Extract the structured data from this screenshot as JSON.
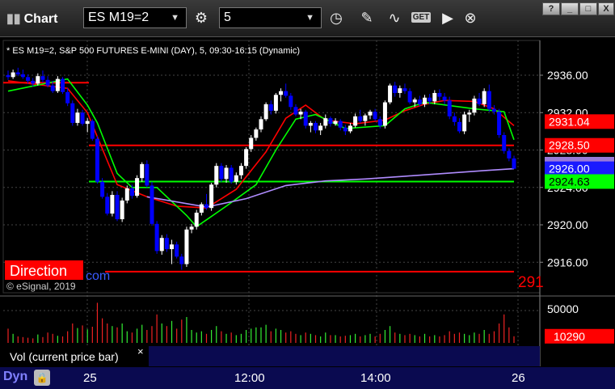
{
  "window": {
    "title": "Chart",
    "symbol": "ES M19=2",
    "interval": "5",
    "get_label": "GET",
    "help_label": "?",
    "minimize_label": "_",
    "maximize_label": "□",
    "close_label": "X"
  },
  "chart_info": {
    "header": "* ES M19=2, S&P 500 FUTURES E-MINI (DAY), 5, 09:30-16:15 (Dynamic)",
    "copyright": "© eSignal, 2019",
    "watermark": "Direction",
    "watermark_suffix": "com",
    "right_cut_label": "291"
  },
  "price_labels": [
    {
      "text": "2931.04",
      "value": 2931.04,
      "bg": "#ff0000",
      "fg": "#ffffff"
    },
    {
      "text": "2928.50",
      "value": 2928.5,
      "bg": "#ff0000",
      "fg": "#ffffff"
    },
    {
      "text": "2926.00",
      "value": 2926.0,
      "bg": "#1a1aff",
      "fg": "#ffffff"
    },
    {
      "text": "2924.63",
      "value": 2924.63,
      "bg": "#00ff00",
      "fg": "#000000"
    }
  ],
  "volume_panel": {
    "label": "Vol (current price bar)",
    "close_label": "×",
    "tick": "50000",
    "current_volume": "10290"
  },
  "bottom_bar": {
    "mode": "Dyn",
    "x_labels": [
      "25",
      "12:00",
      "14:00",
      "26"
    ]
  },
  "colors": {
    "up": "#ffffff",
    "down": "#0000ff",
    "red_ma": "#ff0000",
    "green_ma": "#00ff00",
    "purple_ma": "#b08cff",
    "grid": "#444444",
    "level_red": "#ff0000",
    "level_green": "#00ff00"
  },
  "chart_data": {
    "type": "candlestick",
    "y_ticks": [
      2936,
      2932,
      2928,
      2924,
      2920,
      2916
    ],
    "y_tick_labels": [
      "2936.00",
      "2932.00",
      "2928.00",
      "2924.00",
      "2920.00",
      "2916.00"
    ],
    "ylim": [
      2914.0,
      2940.5
    ],
    "x_labels": [
      "25",
      "12:00",
      "14:00",
      "26"
    ],
    "horizontal_levels": [
      {
        "value": 2935.2,
        "color": "red",
        "extent": "first_session"
      },
      {
        "value": 2928.5,
        "color": "red",
        "extent": "full"
      },
      {
        "value": 2924.63,
        "color": "green",
        "extent": "full"
      },
      {
        "value": 2915.0,
        "color": "red",
        "extent": "full"
      }
    ],
    "candles": [
      [
        2936.0,
        2936.5,
        2935.5,
        2935.8
      ],
      [
        2935.8,
        2936.6,
        2935.6,
        2936.3
      ],
      [
        2936.3,
        2936.8,
        2935.9,
        2936.1
      ],
      [
        2936.1,
        2936.6,
        2935.6,
        2935.8
      ],
      [
        2935.8,
        2936.1,
        2935.1,
        2935.4
      ],
      [
        2935.4,
        2935.7,
        2934.8,
        2935.1
      ],
      [
        2935.1,
        2936.2,
        2934.9,
        2935.9
      ],
      [
        2935.9,
        2936.5,
        2935.2,
        2935.5
      ],
      [
        2935.5,
        2935.9,
        2934.7,
        2934.9
      ],
      [
        2934.9,
        2935.4,
        2934.1,
        2934.3
      ],
      [
        2934.3,
        2935.9,
        2934.1,
        2935.6
      ],
      [
        2935.6,
        2935.8,
        2934.0,
        2934.2
      ],
      [
        2934.2,
        2934.6,
        2932.7,
        2933.0
      ],
      [
        2933.0,
        2933.3,
        2930.6,
        2930.9
      ],
      [
        2930.9,
        2932.4,
        2930.6,
        2932.0
      ],
      [
        2932.0,
        2932.3,
        2930.6,
        2930.8
      ],
      [
        2930.8,
        2931.4,
        2929.9,
        2931.1
      ],
      [
        2931.1,
        2931.3,
        2929.0,
        2929.2
      ],
      [
        2929.2,
        2929.5,
        2924.4,
        2924.6
      ],
      [
        2924.6,
        2925.0,
        2922.8,
        2923.0
      ],
      [
        2923.0,
        2923.4,
        2921.0,
        2921.2
      ],
      [
        2921.2,
        2923.6,
        2920.9,
        2923.2
      ],
      [
        2923.2,
        2923.6,
        2920.4,
        2920.6
      ],
      [
        2920.6,
        2922.9,
        2920.3,
        2922.6
      ],
      [
        2922.6,
        2924.2,
        2922.3,
        2923.9
      ],
      [
        2923.9,
        2924.3,
        2922.8,
        2923.1
      ],
      [
        2923.1,
        2925.3,
        2922.9,
        2925.0
      ],
      [
        2925.0,
        2926.7,
        2924.6,
        2926.5
      ],
      [
        2926.5,
        2926.9,
        2924.0,
        2924.2
      ],
      [
        2924.2,
        2924.6,
        2919.9,
        2920.1
      ],
      [
        2920.1,
        2920.4,
        2916.9,
        2917.2
      ],
      [
        2917.2,
        2918.9,
        2916.8,
        2918.6
      ],
      [
        2918.6,
        2919.0,
        2917.1,
        2917.4
      ],
      [
        2917.4,
        2918.4,
        2915.8,
        2917.9
      ],
      [
        2917.9,
        2918.2,
        2916.4,
        2916.6
      ],
      [
        2916.6,
        2916.9,
        2915.2,
        2915.8
      ],
      [
        2915.8,
        2919.8,
        2915.5,
        2919.5
      ],
      [
        2919.5,
        2920.1,
        2919.1,
        2919.8
      ],
      [
        2919.8,
        2921.6,
        2919.5,
        2921.3
      ],
      [
        2921.3,
        2922.4,
        2921.0,
        2922.2
      ],
      [
        2922.2,
        2923.3,
        2921.6,
        2921.8
      ],
      [
        2921.8,
        2924.5,
        2921.5,
        2924.3
      ],
      [
        2924.3,
        2926.6,
        2924.0,
        2926.3
      ],
      [
        2926.3,
        2926.6,
        2924.6,
        2924.9
      ],
      [
        2924.9,
        2926.4,
        2924.5,
        2926.1
      ],
      [
        2926.1,
        2926.4,
        2924.4,
        2924.6
      ],
      [
        2924.6,
        2925.6,
        2924.3,
        2925.3
      ],
      [
        2925.3,
        2926.6,
        2924.9,
        2926.3
      ],
      [
        2926.3,
        2928.3,
        2926.0,
        2928.1
      ],
      [
        2928.1,
        2929.6,
        2927.8,
        2929.3
      ],
      [
        2929.3,
        2930.4,
        2929.0,
        2930.2
      ],
      [
        2930.2,
        2931.6,
        2929.9,
        2931.3
      ],
      [
        2931.3,
        2933.1,
        2931.1,
        2932.9
      ],
      [
        2932.9,
        2933.3,
        2931.8,
        2932.2
      ],
      [
        2932.2,
        2934.1,
        2931.9,
        2933.9
      ],
      [
        2933.9,
        2934.6,
        2933.2,
        2934.3
      ],
      [
        2934.3,
        2935.1,
        2933.6,
        2933.8
      ],
      [
        2933.8,
        2934.1,
        2932.3,
        2932.6
      ],
      [
        2932.6,
        2932.9,
        2931.6,
        2931.8
      ],
      [
        2931.8,
        2932.4,
        2931.3,
        2932.1
      ],
      [
        2932.1,
        2932.3,
        2930.3,
        2930.6
      ],
      [
        2930.6,
        2931.1,
        2929.9,
        2930.9
      ],
      [
        2930.9,
        2931.1,
        2929.8,
        2930.1
      ],
      [
        2930.1,
        2930.9,
        2929.6,
        2930.6
      ],
      [
        2930.6,
        2931.8,
        2930.3,
        2931.4
      ],
      [
        2931.4,
        2931.6,
        2930.5,
        2930.8
      ],
      [
        2930.8,
        2931.4,
        2930.6,
        2931.1
      ],
      [
        2931.1,
        2931.3,
        2930.1,
        2930.4
      ],
      [
        2930.4,
        2930.7,
        2929.6,
        2930.0
      ],
      [
        2930.0,
        2930.9,
        2929.8,
        2930.6
      ],
      [
        2930.6,
        2931.9,
        2930.4,
        2931.6
      ],
      [
        2931.6,
        2932.3,
        2930.9,
        2931.1
      ],
      [
        2931.1,
        2931.9,
        2930.6,
        2931.7
      ],
      [
        2931.7,
        2932.3,
        2931.3,
        2932.1
      ],
      [
        2932.1,
        2932.4,
        2931.1,
        2931.3
      ],
      [
        2931.3,
        2931.6,
        2930.3,
        2930.6
      ],
      [
        2930.6,
        2933.3,
        2930.3,
        2933.1
      ],
      [
        2933.1,
        2935.1,
        2932.9,
        2934.9
      ],
      [
        2934.9,
        2935.3,
        2933.7,
        2934.1
      ],
      [
        2934.1,
        2934.9,
        2933.6,
        2934.6
      ],
      [
        2934.6,
        2935.1,
        2934.0,
        2934.3
      ],
      [
        2934.3,
        2934.6,
        2932.9,
        2933.1
      ],
      [
        2933.1,
        2933.6,
        2932.6,
        2933.4
      ],
      [
        2933.4,
        2933.8,
        2932.7,
        2932.9
      ],
      [
        2932.9,
        2933.9,
        2932.6,
        2933.6
      ],
      [
        2933.6,
        2934.0,
        2932.9,
        2933.2
      ],
      [
        2933.2,
        2934.4,
        2932.9,
        2934.1
      ],
      [
        2934.1,
        2934.5,
        2933.3,
        2933.7
      ],
      [
        2933.7,
        2934.1,
        2932.9,
        2933.3
      ],
      [
        2933.3,
        2933.7,
        2931.3,
        2931.6
      ],
      [
        2931.6,
        2932.0,
        2930.6,
        2931.0
      ],
      [
        2931.0,
        2931.4,
        2929.8,
        2930.0
      ],
      [
        2930.0,
        2932.1,
        2929.7,
        2931.8
      ],
      [
        2931.8,
        2932.3,
        2931.0,
        2932.0
      ],
      [
        2932.0,
        2933.8,
        2931.7,
        2933.5
      ],
      [
        2933.5,
        2934.1,
        2932.7,
        2932.9
      ],
      [
        2932.9,
        2934.6,
        2932.6,
        2934.3
      ],
      [
        2934.3,
        2935.0,
        2932.1,
        2932.4
      ],
      [
        2932.4,
        2932.8,
        2931.8,
        2932.1
      ],
      [
        2932.1,
        2932.4,
        2929.3,
        2929.6
      ],
      [
        2929.6,
        2929.9,
        2927.6,
        2927.9
      ],
      [
        2927.9,
        2928.2,
        2926.8,
        2927.1
      ],
      [
        2927.1,
        2927.4,
        2926.0,
        2926.0
      ]
    ],
    "series": [
      {
        "name": "red-ma",
        "color": "#ff0000",
        "values": [
          [
            0,
            2935.4
          ],
          [
            12,
            2934.6
          ],
          [
            16,
            2932.0
          ],
          [
            18,
            2929.4
          ],
          [
            22,
            2924.3
          ],
          [
            28,
            2923.0
          ],
          [
            34,
            2922.0
          ],
          [
            40,
            2921.8
          ],
          [
            46,
            2923.8
          ],
          [
            52,
            2927.8
          ],
          [
            56,
            2931.4
          ],
          [
            60,
            2932.8
          ],
          [
            64,
            2931.2
          ],
          [
            70,
            2930.8
          ],
          [
            76,
            2931.2
          ],
          [
            80,
            2932.2
          ],
          [
            84,
            2932.9
          ],
          [
            88,
            2933.3
          ],
          [
            94,
            2933.2
          ],
          [
            98,
            2932.4
          ],
          [
            102,
            2930.6
          ]
        ]
      },
      {
        "name": "green-ma",
        "color": "#00ff00",
        "values": [
          [
            0,
            2934.3
          ],
          [
            12,
            2935.6
          ],
          [
            16,
            2932.8
          ],
          [
            18,
            2930.9
          ],
          [
            22,
            2925.5
          ],
          [
            25,
            2924.0
          ],
          [
            30,
            2924.0
          ],
          [
            36,
            2921.0
          ],
          [
            38,
            2919.8
          ],
          [
            44,
            2922.0
          ],
          [
            50,
            2924.3
          ],
          [
            54,
            2928.0
          ],
          [
            58,
            2931.3
          ],
          [
            62,
            2931.8
          ],
          [
            68,
            2930.3
          ],
          [
            76,
            2930.6
          ],
          [
            80,
            2932.4
          ],
          [
            84,
            2933.1
          ],
          [
            94,
            2932.4
          ],
          [
            100,
            2932.1
          ],
          [
            102,
            2929.1
          ]
        ]
      },
      {
        "name": "purple-ma",
        "color": "#b08cff",
        "values": [
          [
            28,
            2923.0
          ],
          [
            40,
            2921.9
          ],
          [
            48,
            2922.8
          ],
          [
            56,
            2924.2
          ],
          [
            64,
            2924.7
          ],
          [
            72,
            2924.9
          ],
          [
            80,
            2925.2
          ],
          [
            88,
            2925.5
          ],
          [
            96,
            2925.8
          ],
          [
            102,
            2926.0
          ]
        ]
      }
    ],
    "volume": {
      "ylim": [
        0,
        70000
      ],
      "tick": 50000,
      "current": 10290,
      "values": [
        22000,
        14000,
        10000,
        9000,
        8000,
        7000,
        13000,
        9000,
        16000,
        14000,
        11000,
        10000,
        18000,
        30000,
        23000,
        27000,
        21000,
        25000,
        62000,
        38000,
        30000,
        26000,
        24000,
        30000,
        18000,
        16000,
        22000,
        28000,
        20000,
        26000,
        44000,
        30000,
        26000,
        34000,
        22000,
        36000,
        40000,
        20000,
        16000,
        18000,
        14000,
        20000,
        26000,
        18000,
        14000,
        16000,
        12000,
        14000,
        20000,
        22000,
        24000,
        24000,
        28000,
        18000,
        22000,
        20000,
        16000,
        18000,
        14000,
        12000,
        16000,
        14000,
        12000,
        10000,
        16000,
        12000,
        12000,
        10000,
        11000,
        12000,
        14000,
        10000,
        12000,
        14000,
        10000,
        14000,
        20000,
        26000,
        16000,
        14000,
        12000,
        14000,
        12000,
        10000,
        14000,
        10000,
        12000,
        10000,
        12000,
        18000,
        14000,
        16000,
        14000,
        12000,
        16000,
        14000,
        20000,
        14000,
        18000,
        30000,
        44000,
        24000,
        10290
      ]
    }
  }
}
